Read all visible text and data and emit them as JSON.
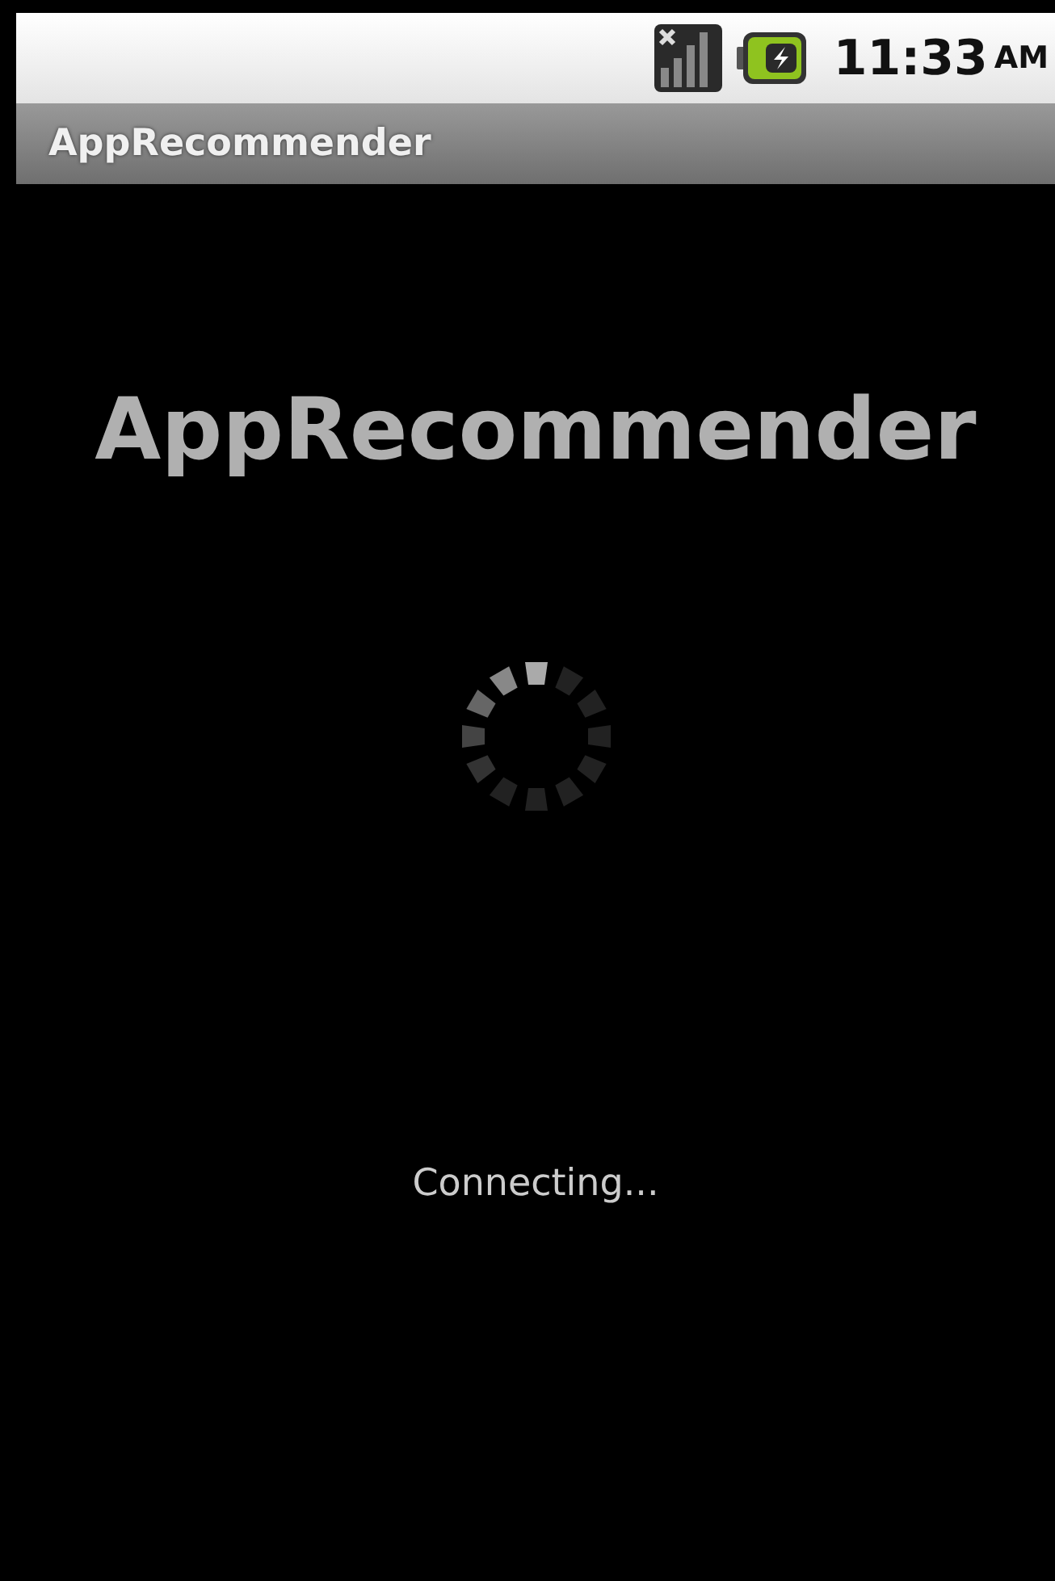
{
  "status_bar": {
    "time": "11:33",
    "meridiem": "AM"
  },
  "title_bar": {
    "title": "AppRecommender"
  },
  "content": {
    "heading": "AppRecommender",
    "message": "Connecting..."
  }
}
